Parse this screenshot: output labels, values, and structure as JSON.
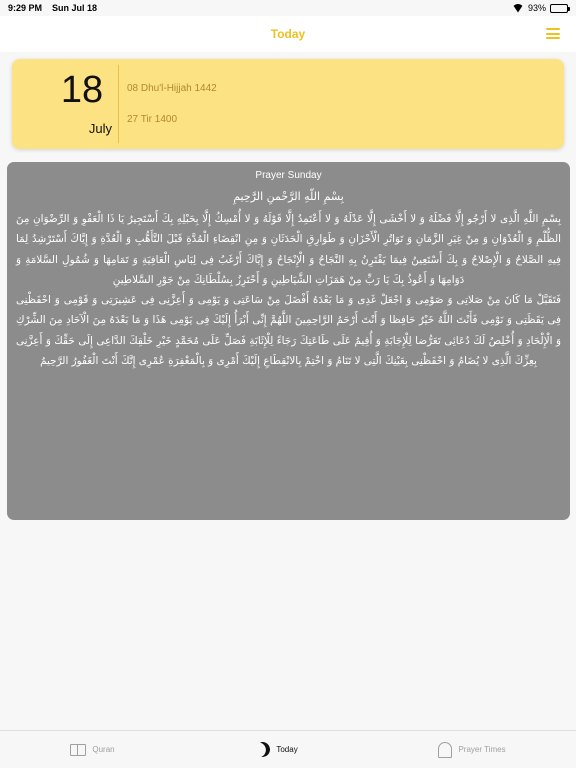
{
  "status_bar": {
    "time": "9:29 PM",
    "date": "Sun Jul 18",
    "battery": "93%",
    "battery_level": 0.93
  },
  "nav": {
    "title": "Today"
  },
  "date_card": {
    "day": "18",
    "month": "July",
    "hijri": "08 Dhu'l-Hijjah 1442",
    "solar": "27 Tir 1400"
  },
  "prayer": {
    "title": "Prayer Sunday",
    "bismillah": "بِسْمِ اللّهِ الرَّحْمنِ الرَّحِيمِ",
    "paragraph1": "بِسْمِ اللَّهِ الَّذِى لا أَرْجُو إِلَّا فَضْلَهُ وَ لا أَخْشَى إِلَّا عَدْلَهُ وَ لا أَعْتَمِدُ إِلَّا قَوْلَهُ وَ لا أُمْسِكُ إِلَّا بِحَبْلِهِ بِكَ أَسْتَجِيرُ يَا ذَا الْعَفْوِ وَ الرِّضْوَانِ مِنَ الظُّلْمِ وَ الْعُدْوَانِ وَ مِنْ غِيَرِ الزَّمَانِ وَ تَوَاتُرِ الْأَحْزَانِ وَ طَوَارِقِ الْحَدَثَانِ وَ مِنِ انْقِضَاءِ الْمُدَّةِ قَبْلَ التَّأَهُّبِ وَ الْعُدَّةِ وَ إِيَّاكَ أَسْتَرْشِدُ لِمَا فِيهِ الصَّلاحُ وَ الْإِصْلاحُ وَ بِكَ أَسْتَعِينُ فِيمَا يَقْتَرِنُ بِهِ النَّجَاحُ وَ الْإِنْجَاحُ وَ إِيَّاكَ أَرْغَبُ فِى لِبَاسِ الْعَافِيَةِ وَ تَمَامِهَا وَ شُمُولِ السَّلامَةِ وَ دَوَامِهَا وَ أَعُوذُ بِكَ يَا رَبِّ مِنْ هَمَزَاتِ الشَّيَاطِينِ وَ أَحْتَرِزُ بِسُلْطَانِكَ مِنْ جَوْرِ السَّلاطِينِ",
    "paragraph2": "فَتَقَبَّلْ مَا كَانَ مِنْ صَلاتِى وَ صَوْمِى وَ اجْعَلْ غَدِى وَ مَا بَعْدَهُ أَفْضَلَ مِنْ سَاعَتِى وَ يَوْمِى وَ أَعِزَّنِى فِى عَشِيرَتِى وَ قَوْمِى وَ احْفَظْنِى فِى يَقَظَتِى وَ نَوْمِى فَأَنْتَ اللَّهُ خَيْرٌ حَافِظا وَ أَنْتَ أَرْحَمُ الرَّاحِمِينَ اللَّهُمَّ إِنِّى أَبْرَأُ إِلَيْكَ فِى يَوْمِى هَذَا وَ مَا بَعْدَهُ مِنَ الْآحَادِ مِنَ الشِّرْكِ وَ الْإِلْحَادِ وَ أُخْلِصُ لَكَ دُعَائِى تَعَرُّضا لِلْإِجَابَةِ وَ أُقِيمُ عَلَى طَاعَتِكَ رَجَاءً لِلْإِثَابَةِ فَصَلِّ عَلَى مُحَمَّدٍ خَيْرِ خَلْقِكَ الدَّاعِى إِلَى حَقِّكَ وَ أَعِزَّنِى بِعِزِّكَ الَّذِى لا يُضَامُ وَ احْفَظْنِى بِعَيْنِكَ الَّتِى لا تَنَامُ وَ اخْتِمْ بِالانْقِطَاعِ إِلَيْكَ أَمْرِى وَ بِالْمَغْفِرَةِ عُمْرِى إِنَّكَ أَنْتَ الْغَفُورُ الرَّحِيمُ"
  },
  "tabs": [
    {
      "label": "Quran",
      "icon": "book-icon"
    },
    {
      "label": "Today",
      "icon": "moon-icon"
    },
    {
      "label": "Prayer Times",
      "icon": "mosque-icon"
    }
  ],
  "colors": {
    "accent": "#f0c020",
    "card": "#fde283",
    "prayer_bg": "#8c8c8c"
  }
}
